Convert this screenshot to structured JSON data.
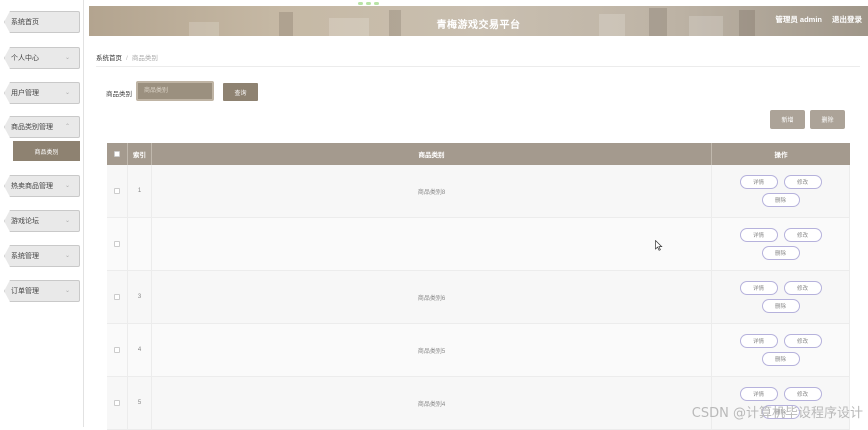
{
  "header": {
    "title": "青梅游戏交易平台",
    "user": "管理员 admin",
    "logout": "退出登录"
  },
  "sidebar": {
    "items": [
      {
        "label": "系统首页",
        "has_arrow": false
      },
      {
        "label": "个人中心",
        "has_arrow": true
      },
      {
        "label": "用户管理",
        "has_arrow": true
      },
      {
        "label": "商品类别管理",
        "has_arrow": true
      },
      {
        "label": "热卖商品管理",
        "has_arrow": true
      },
      {
        "label": "游戏论坛",
        "has_arrow": true
      },
      {
        "label": "系统管理",
        "has_arrow": true
      },
      {
        "label": "订单管理",
        "has_arrow": true
      }
    ],
    "submenu": {
      "label": "商品类别"
    }
  },
  "breadcrumb": {
    "home": "系统首页",
    "current": "商品类别"
  },
  "search": {
    "label": "商品类别",
    "placeholder": "商品类别",
    "button": "查询"
  },
  "actions": {
    "add": "新增",
    "delete": "删除"
  },
  "table": {
    "headers": {
      "index": "索引",
      "name": "商品类别",
      "ops": "操作"
    },
    "op_labels": {
      "detail": "详情",
      "edit": "修改",
      "delete": "删除"
    },
    "rows": [
      {
        "index": "1",
        "name": "商品类别8"
      },
      {
        "index": "",
        "name": ""
      },
      {
        "index": "3",
        "name": "商品类别6"
      },
      {
        "index": "4",
        "name": "商品类别5"
      },
      {
        "index": "5",
        "name": "商品类别4"
      }
    ]
  },
  "watermark": "CSDN @计算机毕设程序设计",
  "colors": {
    "accent": "#8e8271",
    "table_header": "#a49a8e",
    "op_border": "#b6b2dc"
  }
}
